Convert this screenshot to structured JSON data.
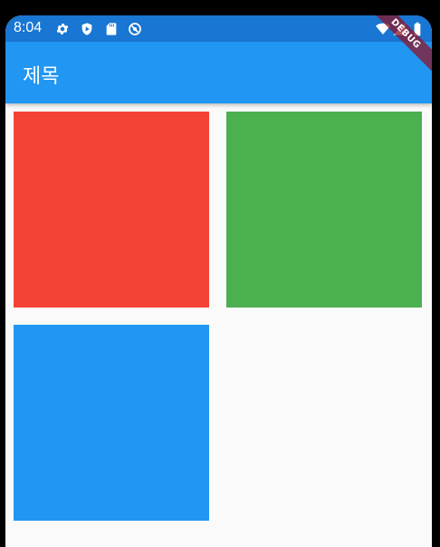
{
  "status_bar": {
    "time": "8:04",
    "left_icons": [
      "settings-icon",
      "shield-icon",
      "sd-card-icon",
      "no-disturb-icon"
    ],
    "right_icons": [
      "wifi-icon",
      "signal-icon",
      "battery-icon"
    ]
  },
  "app_bar": {
    "title": "제목",
    "color": "#2196f3"
  },
  "debug_banner": "DEBUG",
  "tiles": [
    {
      "color": "#f44336"
    },
    {
      "color": "#4caf50"
    },
    {
      "color": "#2196f3"
    }
  ]
}
